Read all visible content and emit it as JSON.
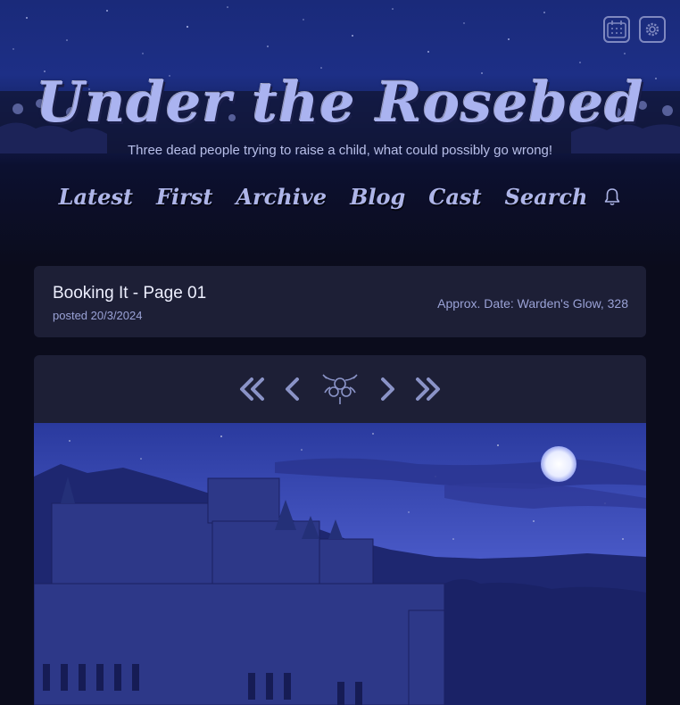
{
  "header": {
    "title": "Under the Rosebed",
    "tagline": "Three dead people trying to raise a child, what could possibly go wrong!",
    "icons": [
      "calendar-icon",
      "settings-gear-icon"
    ]
  },
  "nav": {
    "items": [
      "Latest",
      "First",
      "Archive",
      "Blog",
      "Cast",
      "Search"
    ],
    "notification_icon": "bell-icon"
  },
  "post": {
    "title": "Booking It - Page 01",
    "posted": "posted 20/3/2024",
    "approx_date": "Approx. Date: Warden's Glow, 328"
  },
  "comic_nav": {
    "icons": [
      "double-chevron-left-icon",
      "chevron-left-icon",
      "rose-emblem-icon",
      "chevron-right-icon",
      "double-chevron-right-icon"
    ]
  },
  "colors": {
    "background": "#0b0c1c",
    "card": "#1d1f36",
    "accent": "#8a93c7",
    "title": "#aab3f0"
  }
}
